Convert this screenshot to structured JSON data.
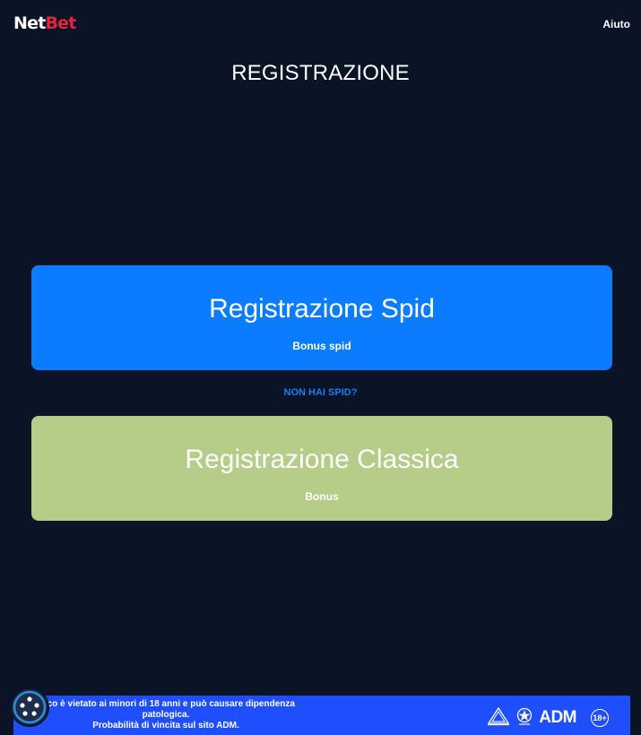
{
  "header": {
    "logo_net": "Net",
    "logo_bet": "Bet",
    "help_label": "Aiuto"
  },
  "page_title": "REGISTRAZIONE",
  "spid_card": {
    "title": "Registrazione Spid",
    "subtitle": "Bonus spid"
  },
  "no_spid_link": "NON HAI SPID?",
  "classic_card": {
    "title": "Registrazione Classica",
    "subtitle": "Bonus"
  },
  "footer": {
    "warning_line1": "occo è vietato ai minori di 18 anni e può causare dipendenza",
    "warning_line2": "patologica.",
    "warning_line3": "Probabilità di vincita sul sito ADM.",
    "adm_label": "ADM",
    "age_label": "18+"
  },
  "colors": {
    "background": "#0b1426",
    "spid_card": "#0a7cff",
    "classic_card": "#b6cd8a",
    "brand_red": "#e3243b",
    "link_blue": "#1e7cf2",
    "footer_banner": "#1f4ffc"
  },
  "icons": {
    "cookie": "cookie-settings-icon",
    "adm_emblem": "adm-emblem-icon",
    "republic_emblem": "italian-republic-emblem-icon"
  }
}
